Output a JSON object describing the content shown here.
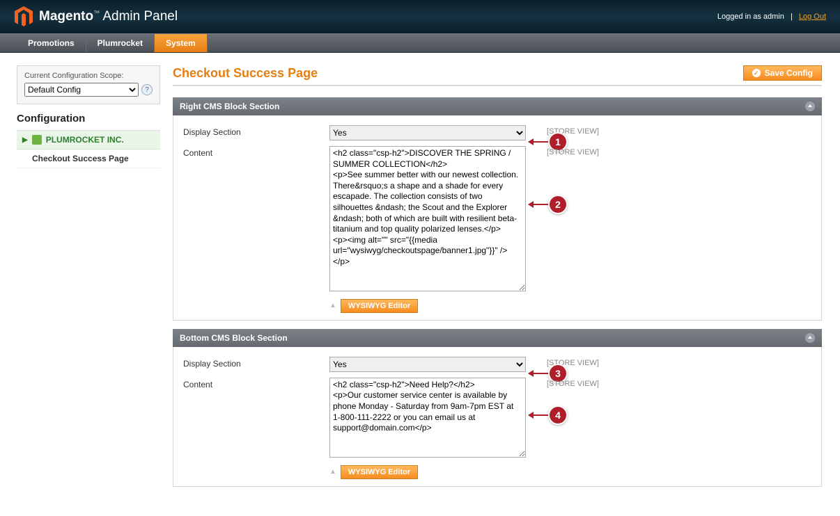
{
  "header": {
    "logo_brand": "Magento",
    "logo_sub": "Admin Panel",
    "logged_in": "Logged in as admin",
    "logout": "Log Out"
  },
  "menu": {
    "items": [
      "Promotions",
      "Plumrocket",
      "System"
    ],
    "active": "System"
  },
  "sidebar": {
    "scope_label": "Current Configuration Scope:",
    "scope_value": "Default Config",
    "config_heading": "Configuration",
    "group": "PLUMROCKET INC.",
    "link": "Checkout Success Page"
  },
  "page": {
    "title": "Checkout Success Page",
    "save": "Save Config"
  },
  "sections": [
    {
      "title": "Right CMS Block Section",
      "display": {
        "label": "Display Section",
        "value": "Yes",
        "scope": "[STORE VIEW]"
      },
      "content": {
        "label": "Content",
        "value": "<h2 class=\"csp-h2\">DISCOVER THE SPRING / SUMMER COLLECTION</h2>\n<p>See summer better with our newest collection. There&rsquo;s a shape and a shade for every escapade. The collection consists of two silhouettes &ndash; the Scout and the Explorer &ndash; both of which are built with resilient beta-titanium and top quality polarized lenses.</p>\n<p><img alt=\"\" src=\"{{media url=\"wysiwyg/checkoutspage/banner1.jpg\"}}\" /></p>",
        "scope": "[STORE VIEW]",
        "rows": 13
      },
      "editor": "WYSIWYG Editor"
    },
    {
      "title": "Bottom CMS Block Section",
      "display": {
        "label": "Display Section",
        "value": "Yes",
        "scope": "[STORE VIEW]"
      },
      "content": {
        "label": "Content",
        "value": "<h2 class=\"csp-h2\">Need Help?</h2>\n<p>Our customer service center is available by phone Monday - Saturday from 9am-7pm EST at 1-800-111-2222 or you can email us at support@domain.com</p>",
        "scope": "[STORE VIEW]",
        "rows": 7
      },
      "editor": "WYSIWYG Editor"
    }
  ],
  "annotations": [
    {
      "n": "1",
      "section": 0,
      "row": "display"
    },
    {
      "n": "2",
      "section": 0,
      "row": "content"
    },
    {
      "n": "3",
      "section": 1,
      "row": "display"
    },
    {
      "n": "4",
      "section": 1,
      "row": "content"
    }
  ]
}
